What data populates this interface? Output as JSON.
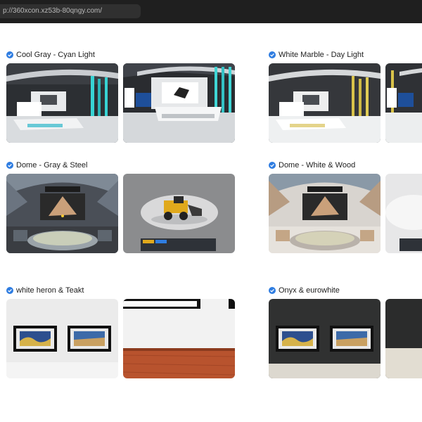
{
  "browser": {
    "url": "p://360xcon.xz53b-80qngy.com/"
  },
  "sections": [
    {
      "title": "Cool Gray - Cyan Light"
    },
    {
      "title": "White Marble - Day Light"
    },
    {
      "title": "Dome - Gray & Steel"
    },
    {
      "title": "Dome - White & Wood"
    },
    {
      "title": "white heron & Teakt"
    },
    {
      "title": "Onyx & eurowhite"
    }
  ],
  "icons": {
    "section_check": "check-circle-icon"
  },
  "colors": {
    "accent": "#2f7de1",
    "topbar": "#1f1f1f",
    "url_field": "#303030"
  }
}
